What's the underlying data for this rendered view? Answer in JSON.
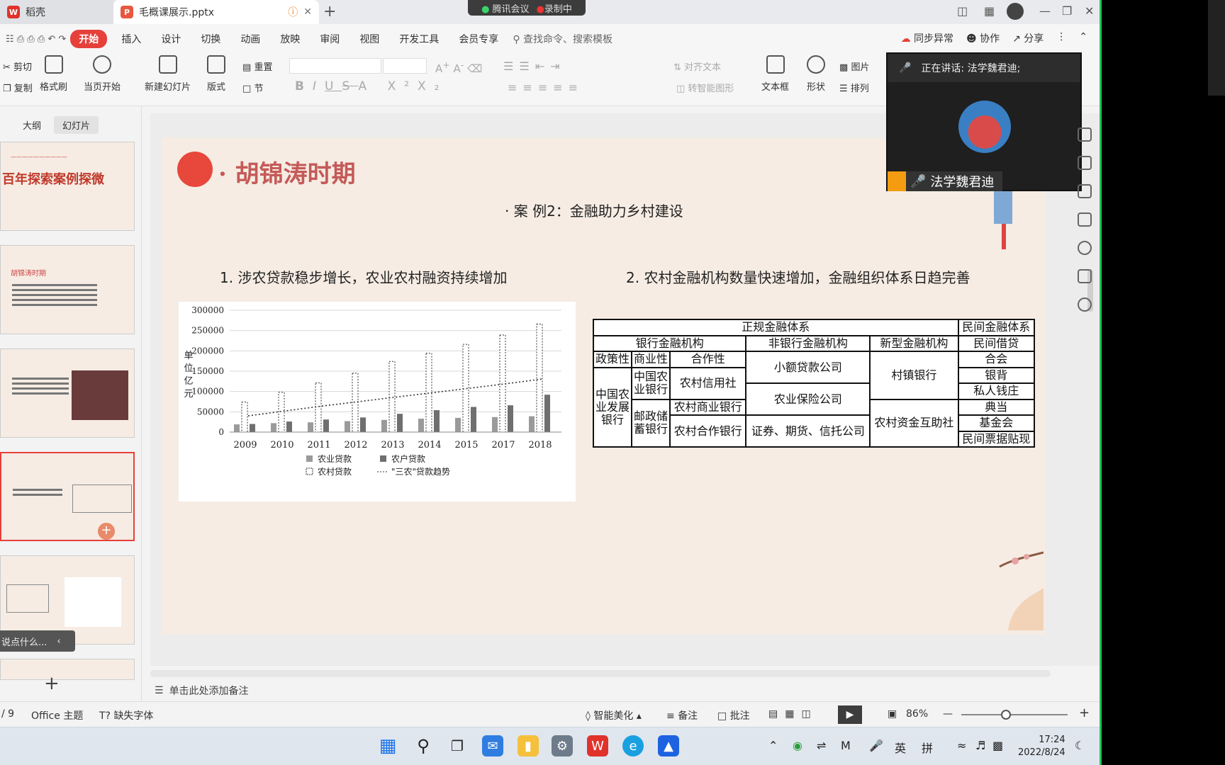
{
  "titlebar": {
    "tab1": "稻壳",
    "tab2": "毛概课展示.pptx",
    "add_tab": "+",
    "meeting": "腾讯会议",
    "recording": "录制中"
  },
  "menu": {
    "items": [
      "开始",
      "插入",
      "设计",
      "切换",
      "动画",
      "放映",
      "审阅",
      "视图",
      "开发工具",
      "会员专享"
    ],
    "search": "查找命令、搜索模板",
    "sync": "同步异常",
    "collab": "协作",
    "share": "分享"
  },
  "ribbon": {
    "cut": "剪切",
    "copy": "复制",
    "format_painter": "格式刷",
    "play_current": "当页开始",
    "new_slide": "新建幻灯片",
    "layout": "版式",
    "reset": "重置",
    "section": "节",
    "align_text": "对齐文本",
    "smart_shape": "转智能图形",
    "textbox": "文本框",
    "shape": "形状",
    "picture": "图片",
    "arrange": "排列"
  },
  "left_pane": {
    "tab_outline": "大纲",
    "tab_slides": "幻灯片",
    "thumb1_title": "百年探索案例探微",
    "thumb2_title": "胡锦涛时期",
    "comment_prompt": "说点什么...",
    "add": "+"
  },
  "slide": {
    "title": "· 胡锦涛时期",
    "subtitle": "· 案 例2：金融助力乡村建设",
    "point1": "1. 涉农贷款稳步增长，农业农村融资持续增加",
    "point2": "2. 农村金融机构数量快速增加，金融组织体系日趋完善"
  },
  "chart_data": {
    "type": "bar",
    "categories": [
      "2009",
      "2010",
      "2011",
      "2012",
      "2013",
      "2014",
      "2015",
      "2017",
      "2018"
    ],
    "ylabel": "单位：亿元",
    "ylim": [
      0,
      300000
    ],
    "yticks": [
      "0",
      "50000",
      "100000",
      "150000",
      "200000",
      "250000",
      "300000"
    ],
    "series": [
      {
        "name": "农业贷款",
        "values": [
          19000,
          22000,
          24000,
          27000,
          30000,
          33000,
          35000,
          37000,
          39000
        ]
      },
      {
        "name": "农户贷款",
        "values": [
          20000,
          26000,
          31000,
          36000,
          45000,
          54000,
          62000,
          66000,
          92000
        ]
      },
      {
        "name": "农村贷款",
        "values": [
          74000,
          98000,
          121000,
          145000,
          174000,
          194000,
          216000,
          239000,
          266000
        ]
      }
    ],
    "trend_name": "\"三农\"贷款趋势",
    "trend": [
      40000,
      52000,
      64000,
      75000,
      86000,
      97000,
      108000,
      119000,
      131000
    ]
  },
  "table": {
    "formal": "正规金融体系",
    "informal": "民间金融体系",
    "bank": "银行金融机构",
    "nonbank": "非银行金融机构",
    "new_type": "新型金融机构",
    "private_lending": "民间借贷",
    "policy": "政策性",
    "commercial": "商业性",
    "cooperative": "合作性",
    "adbc": "中国农业发展银行",
    "abc": "中国农业银行",
    "psbc": "邮政储蓄银行",
    "rcc": "农村信用社",
    "rcb": "农村商业银行",
    "rcoop": "农村合作银行",
    "microloan": "小额贷款公司",
    "agri_insurance": "农业保险公司",
    "securities": "证券、期货、信托公司",
    "village_bank": "村镇银行",
    "mutual_fund": "农村资金互助社",
    "heh": "合会",
    "yinbei": "银背",
    "private_shop": "私人钱庄",
    "pawn": "典当",
    "foundation": "基金会",
    "bill_discount": "民间票据贴现"
  },
  "notes": "单击此处添加备注",
  "statusbar": {
    "page": "/ 9",
    "theme": "Office 主题",
    "missing_font": "缺失字体",
    "beautify": "智能美化",
    "notes": "备注",
    "comment": "批注",
    "zoom": "86%"
  },
  "video": {
    "speaking": "正在讲话: 法学魏君迪;",
    "name": "法学魏君迪"
  },
  "taskbar": {
    "ime1": "英",
    "ime2": "拼",
    "time": "17:24",
    "date": "2022/8/24"
  },
  "colors": {
    "accent": "#e6403a",
    "slide_bg": "#f6ece3",
    "title": "#c45a58"
  }
}
